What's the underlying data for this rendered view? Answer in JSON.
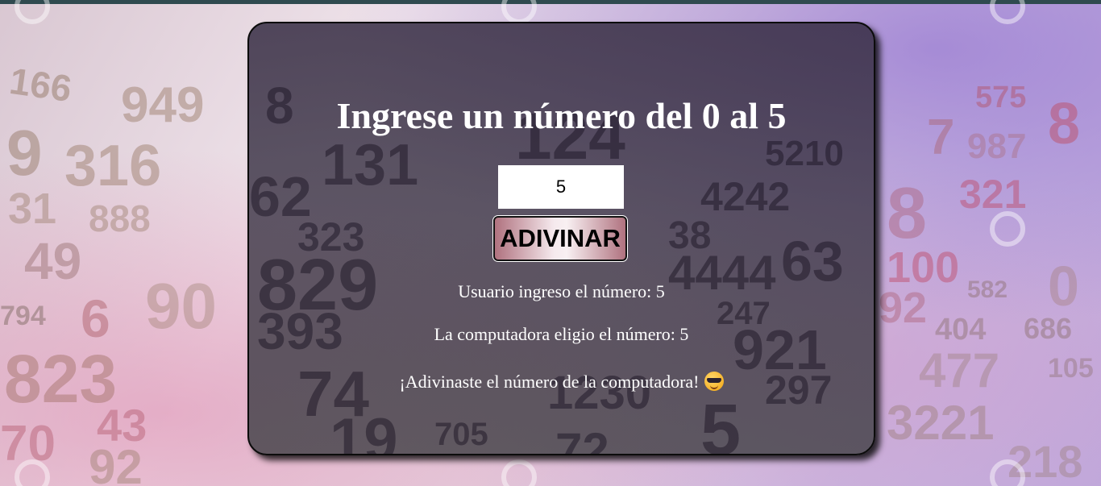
{
  "game": {
    "title": "Ingrese un número del 0 al 5",
    "input_value": "5",
    "button_label": "ADIVINAR",
    "user_line": "Usuario ingreso el número: 5",
    "computer_line": "La computadora eligio el número: 5",
    "result_line": "¡Adivinaste el número de la computadora!",
    "result_emoji": "smiling-face-with-sunglasses-icon"
  },
  "colors": {
    "panel_background": "#3e3848",
    "title_text": "#ffffff",
    "button_gradient_edge": "#b0727f",
    "button_gradient_center": "#f5e9ed",
    "top_strip": "#2f4a4f"
  }
}
